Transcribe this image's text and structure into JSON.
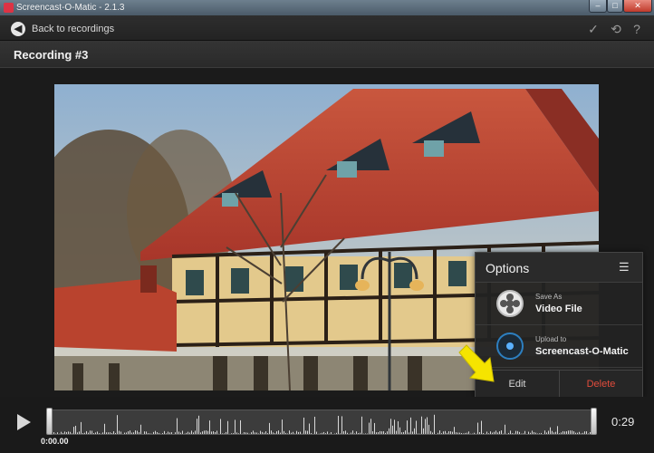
{
  "window": {
    "title": "Screencast-O-Matic - 2.1.3",
    "buttons": {
      "minimize": "–",
      "maximize": "□",
      "close": "✕"
    }
  },
  "toolbar": {
    "back_label": "Back to recordings",
    "icons": [
      "check-icon",
      "history-icon",
      "help-icon"
    ],
    "check_glyph": "✓",
    "history_glyph": "⟲",
    "help_glyph": "?"
  },
  "header": {
    "title": "Recording #3"
  },
  "options": {
    "title": "Options",
    "menu_glyph": "☰",
    "items": [
      {
        "small": "Save As",
        "label": "Video File",
        "icon": "film-reel-icon"
      },
      {
        "small": "Upload to",
        "label": "Screencast-O-Matic",
        "icon": "upload-icon"
      }
    ],
    "edit_label": "Edit",
    "delete_label": "Delete"
  },
  "player": {
    "start_time": "0:00.00",
    "end_time": "0:29",
    "colors": {
      "accent": "#2d7fc0",
      "delete": "#e24c3c",
      "arrow": "#f5e400"
    }
  }
}
